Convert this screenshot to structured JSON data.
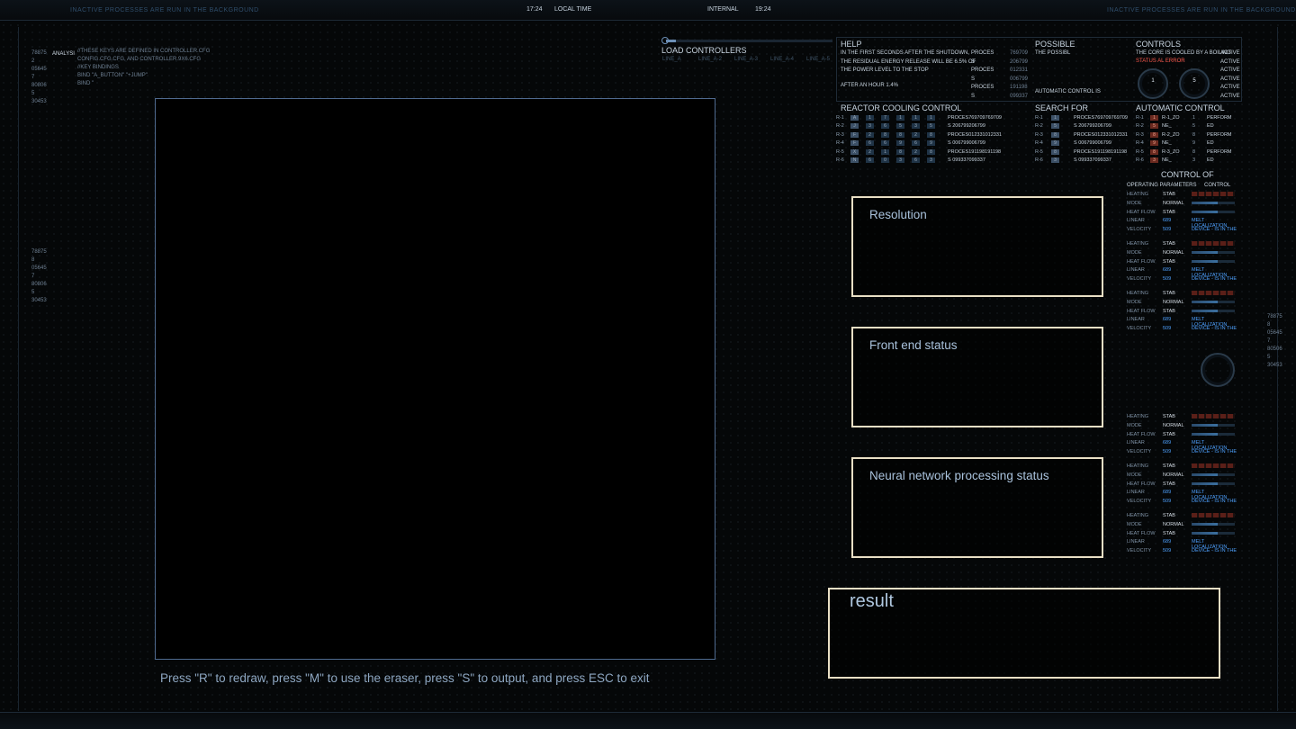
{
  "top_bar": {
    "left_notice": "INACTIVE PROCESSES ARE RUN IN THE BACKGROUND",
    "right_notice": "INACTIVE PROCESSES ARE RUN IN THE BACKGROUND",
    "time_left": "17:24",
    "local_time_label": "LOCAL TIME",
    "internal_label": "INTERNAL",
    "time_right": "19:24"
  },
  "left_hud": {
    "numbers": "78875\n2\n05645\n7\n80806\n5\n30453",
    "analysis_label": "ANALYSI",
    "code_lines": "//THESE KEYS ARE DEFINED IN CONTROLLER.CFG\nCONFIG.CFG.CFG, AND CONTROLLER.9X6.CFG\n//KEY BINDINGS\nBIND \"A_BUTTON\" \"+JUMP\"\nBIND \"",
    "numbers_lower": "78875\n8\n05645\n7\n80806\n5\n30453"
  },
  "right_hud_numbers": "78875\n8\n05645\n7\n80506\n5\n30453",
  "load_controllers": {
    "title": "LOAD CONTROLLERS",
    "lines": [
      "LINE_A",
      "LINE_A-2",
      "LINE_A-3",
      "LINE_A-4",
      "LINE_A-5"
    ]
  },
  "help_panel": {
    "title": "HELP",
    "text": "IN THE FIRST SECONDS AFTER THE SHUTDOWN,\nTHE RESIDUAL ENERGY RELEASE WILL BE 6.5% OF\nTHE POWER LEVEL TO THE STOP",
    "after_hour": "AFTER AN HOUR 1.4%",
    "proces_lines": [
      [
        "PROCES",
        "769709"
      ],
      [
        "S",
        "206799"
      ],
      [
        "PROCES",
        "012331"
      ],
      [
        "S",
        "006799"
      ],
      [
        "PROCES",
        "191198"
      ],
      [
        "S",
        "099337"
      ]
    ],
    "possible_title": "POSSIBLE",
    "possible_text": "THE POSSIBL",
    "automatic_control_is": "AUTOMATIC CONTROL IS",
    "controls_title": "CONTROLS",
    "controls_text": "THE CORE IS COOLED BY A BOILING",
    "status_text": "STATUS AL ERROR",
    "active_items": [
      "ACTIVE",
      "ACTIVE",
      "ACTIVE",
      "ACTIVE",
      "ACTIVE",
      "ACTIVE"
    ],
    "gauge_values": [
      "1",
      "5"
    ]
  },
  "reactor_cooling": {
    "title": "REACTOR COOLING CONTROL",
    "rows": [
      {
        "id": "R-1",
        "cells": [
          "A",
          "1",
          "7",
          "1",
          "1",
          "1"
        ],
        "proc": "PROCES769709769709"
      },
      {
        "id": "R-2",
        "cells": [
          "J",
          "3",
          "6",
          "5",
          "3",
          "5"
        ],
        "proc": "S 206799206799"
      },
      {
        "id": "R-3",
        "cells": [
          "F",
          "2",
          "8",
          "8",
          "2",
          "8"
        ],
        "proc": "PROCES012331012331"
      },
      {
        "id": "R-4",
        "cells": [
          "F",
          "6",
          "6",
          "9",
          "6",
          "9"
        ],
        "proc": "S 006799006799"
      },
      {
        "id": "R-5",
        "cells": [
          "X",
          "2",
          "1",
          "8",
          "2",
          "8"
        ],
        "proc": "PROCES191198191198"
      },
      {
        "id": "R-6",
        "cells": [
          "N",
          "6",
          "0",
          "3",
          "6",
          "3"
        ],
        "proc": "S 099337099337"
      }
    ]
  },
  "search_for": {
    "title": "SEARCH FOR",
    "rows": [
      {
        "id": "R-1",
        "n": "1",
        "proc": "PROCES769709769709"
      },
      {
        "id": "R-2",
        "n": "5",
        "proc": "S 206799206799"
      },
      {
        "id": "R-3",
        "n": "8",
        "proc": "PROCES012331012331"
      },
      {
        "id": "R-4",
        "n": "9",
        "proc": "S 006799006799"
      },
      {
        "id": "R-5",
        "n": "8",
        "proc": "PROCES191198191198"
      },
      {
        "id": "R-6",
        "n": "3",
        "proc": "S 099337099337"
      }
    ]
  },
  "automatic_control": {
    "title": "AUTOMATIC CONTROL",
    "rows": [
      {
        "id": "R-1",
        "n": "1",
        "code": "R-1_ZO",
        "v": "1",
        "t": "PERFORM"
      },
      {
        "id": "R-2",
        "n": "5",
        "code": "NE_",
        "v": "5",
        "t": "ED"
      },
      {
        "id": "R-3",
        "n": "8",
        "code": "R-2_ZO",
        "v": "8",
        "t": "PERFORM"
      },
      {
        "id": "R-4",
        "n": "9",
        "code": "NE_",
        "v": "9",
        "t": "ED"
      },
      {
        "id": "R-5",
        "n": "8",
        "code": "R-3_ZO",
        "v": "8",
        "t": "PERFORM"
      },
      {
        "id": "R-6",
        "n": "3",
        "code": "NE_",
        "v": "3",
        "t": "ED"
      }
    ]
  },
  "control_of": {
    "title": "CONTROL OF",
    "col1": "OPERATING PARAMETERS",
    "col2": "CONTROL",
    "block": [
      {
        "k": "HEATING",
        "v": "STAB"
      },
      {
        "k": "MODE",
        "v": "NORMAL"
      },
      {
        "k": "HEAT FLOW",
        "v": "STAB"
      },
      {
        "k": "LINEAR",
        "v": "689"
      },
      {
        "k": "VELOCITY",
        "v": "509"
      }
    ],
    "meltline": "MELT LOCALIZATION",
    "device": "DEVICE - IS IN THE"
  },
  "status_boxes": {
    "resolution": "Resolution",
    "front_end": "Front end status",
    "neural": "Neural network processing status",
    "result": "result"
  },
  "hint": "Press \"R\" to redraw, press \"M\" to use the eraser, press \"S\" to output, and press ESC to exit"
}
